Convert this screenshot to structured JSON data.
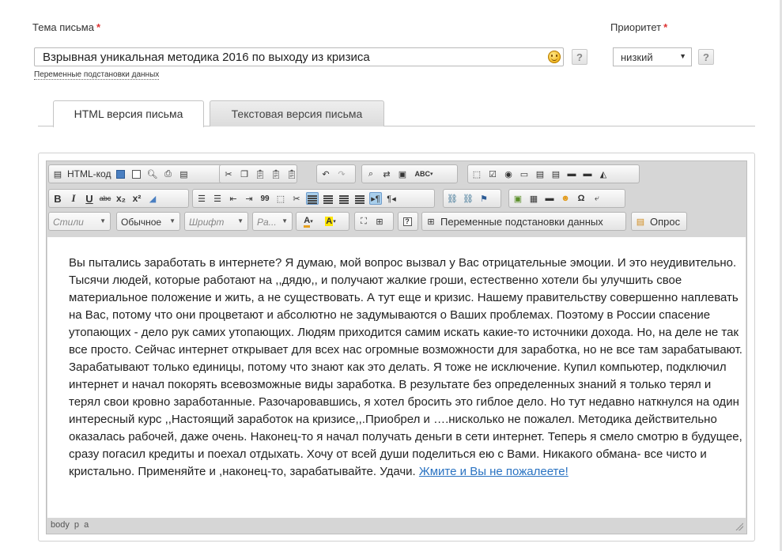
{
  "subject": {
    "label": "Тема письма",
    "required_mark": "*",
    "value": "Взрывная уникальная методика 2016 по выходу из кризиса",
    "help": "?",
    "variables_link": "Переменные подстановки данных"
  },
  "priority": {
    "label": "Приоритет",
    "required_mark": "*",
    "value": "низкий",
    "help": "?"
  },
  "tabs": [
    {
      "label": "HTML версия письма",
      "active": true
    },
    {
      "label": "Текстовая версия письма",
      "active": false
    }
  ],
  "toolbar": {
    "html_code_label": "HTML-код",
    "styles_placeholder": "Стили",
    "format_value": "Обычное",
    "font_placeholder": "Шрифт",
    "size_placeholder": "Ра...",
    "variables_button": "Переменные подстановки данных",
    "poll_button": "Опрос",
    "bold": "B",
    "italic": "I",
    "underline": "U",
    "strike": "abc",
    "subscript": "x₂",
    "superscript": "x²",
    "spellcheck": "ABC",
    "blockquote": "99"
  },
  "content": {
    "body_text": " Вы пытались заработать в интернете? Я думаю, мой вопрос вызвал у Вас отрицательные эмоции. И это неудивительно. Тысячи людей, которые работают на ,,дядю,, и получают жалкие гроши, естественно хотели бы улучшить свое материальное положение и жить, а не существовать. А тут еще и кризис. Нашему правительству совершенно наплевать на Вас, потому что они процветают и абсолютно не задумываются о Ваших проблемах. Поэтому в России спасение утопающих - дело рук самих утопающих. Людям приходится самим искать какие-то источники дохода. Но, на деле не так все просто. Сейчас интернет открывает для всех нас огромные возможности для заработка, но не все там зарабатывают. Зарабатывают только единицы, потому что знают как это делать. Я тоже не исключение. Купил компьютер, подключил интернет и начал покорять всевозможные виды заработка. В результате без определенных знаний я только терял и терял свои кровно заработанные. Разочаровавшись, я хотел бросить это гиблое дело. Но тут недавно наткнулся на один интересный курс ,,Настоящий заработок на кризисе,,.Приобрел и ….нисколько не пожалел. Методика действительно оказалась рабочей, даже очень. Наконец-то я начал получать деньги в сети интернет. Теперь я смело смотрю в будущее, сразу погасил кредиты и поехал отдыхать. Хочу от всей души поделиться ею с Вами. Никакого обмана- все чисто и кристально. Применяйте и ,наконец-то, зарабатывайте. Удачи. ",
    "link_text": "Жмите и Вы не пожалеете!"
  },
  "statusbar": {
    "path": "body p a"
  }
}
